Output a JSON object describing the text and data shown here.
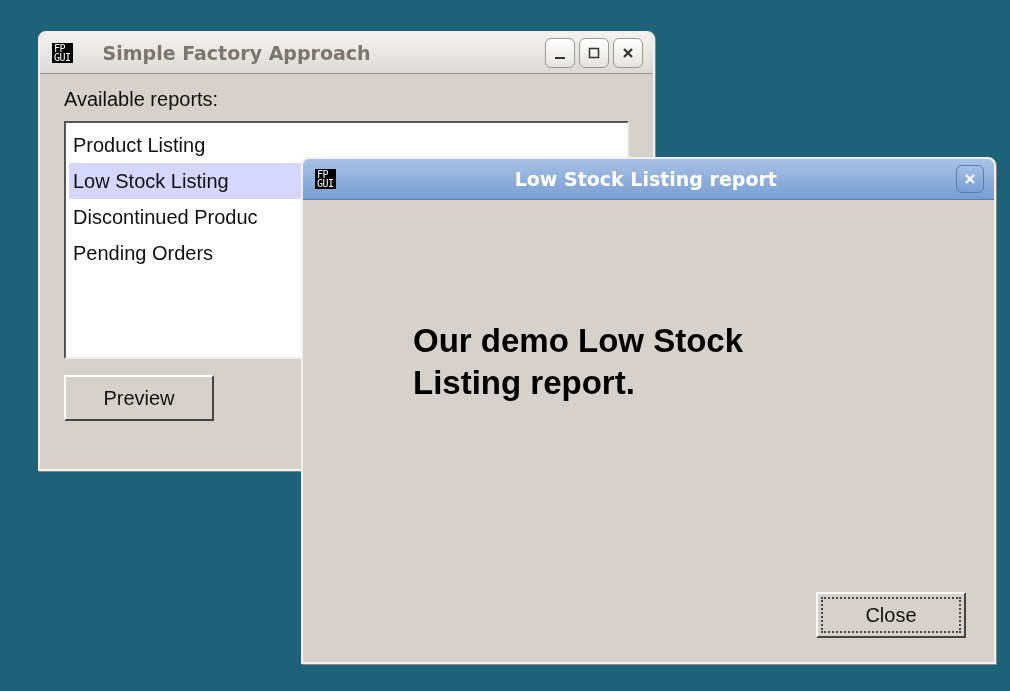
{
  "main_window": {
    "icon_text": [
      "FP",
      "GUI"
    ],
    "title": "Simple Factory Approach",
    "active": false,
    "label": "Available reports:",
    "reports": [
      {
        "label": "Product Listing",
        "selected": false
      },
      {
        "label": "Low Stock Listing",
        "selected": true
      },
      {
        "label": "Discontinued Produc",
        "selected": false
      },
      {
        "label": "Pending Orders",
        "selected": false
      }
    ],
    "button": "Preview"
  },
  "report_window": {
    "icon_text": [
      "FP",
      "GUI"
    ],
    "title": "Low Stock Listing report",
    "active": true,
    "message": "Our demo Low Stock Listing report.",
    "button": "Close"
  }
}
